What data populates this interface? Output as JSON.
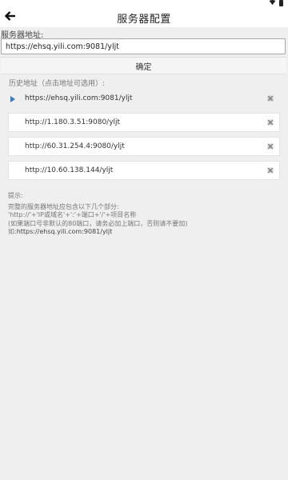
{
  "header": {
    "title": "服务器配置"
  },
  "form": {
    "address_label": "服务器地址:",
    "address_value": "https://ehsq.yili.com:9081/yljt",
    "confirm_label": "确定"
  },
  "history": {
    "label": "历史地址（点击地址可选用）:",
    "items": [
      {
        "url": "https://ehsq.yili.com:9081/yljt",
        "selected": true
      },
      {
        "url": "http://1.180.3.51:9080/yljt",
        "selected": false
      },
      {
        "url": "http://60.31.254.4:9080/yljt",
        "selected": false
      },
      {
        "url": "http://10.60.138.144/yljt",
        "selected": false
      }
    ],
    "selected_indicator_icon": "play-icon",
    "delete_icon": "delete-icon"
  },
  "hint": {
    "title": "提示:",
    "lines": [
      "完整的服务器地址应包含以下几个部分:",
      "'http://'+'IP或域名'+':'+端口+'/'+项目名称",
      "(如果端口号非默认的80端口，请务必加上端口，否则请不要加)"
    ],
    "example_label": "如:",
    "example_value": "https://ehsq.yili.com:9081/yljt"
  },
  "colors": {
    "background": "#efefef",
    "accent": "#3a78c2",
    "delete_icon": "#8a8a8a"
  }
}
